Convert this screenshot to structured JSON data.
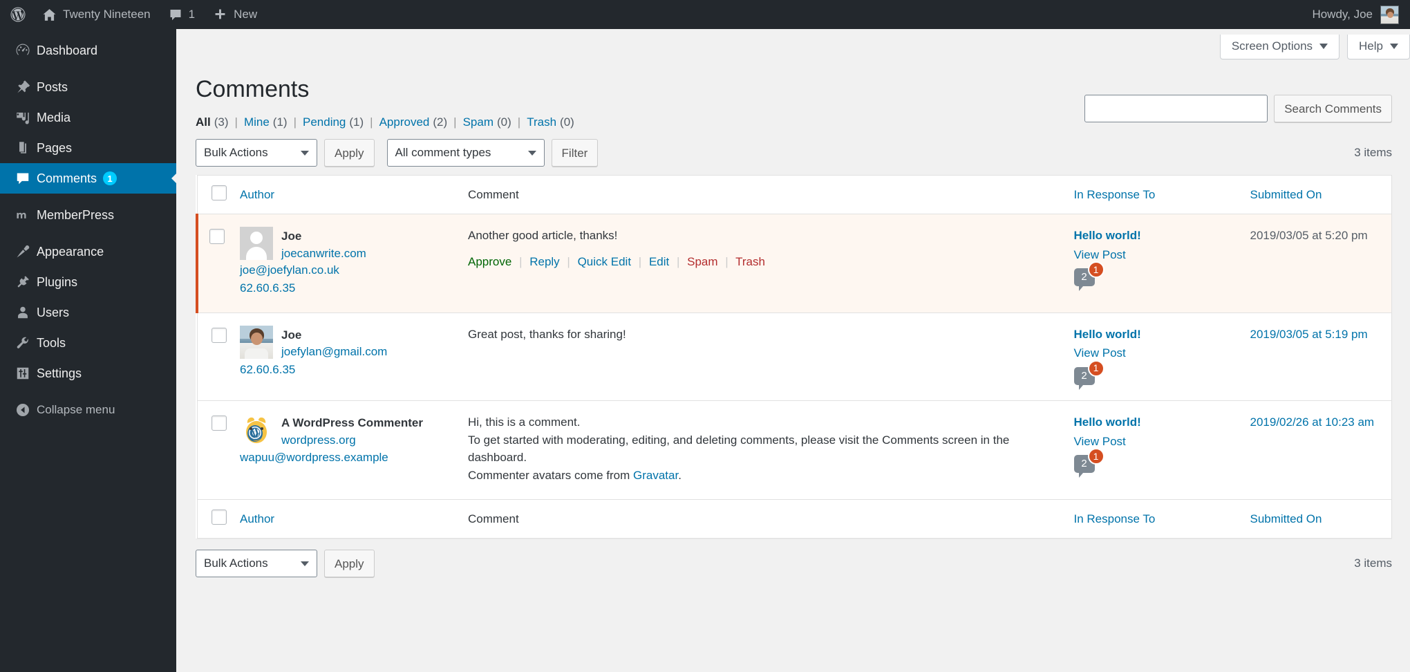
{
  "adminbar": {
    "wp_logo": "wordpress-logo-icon",
    "site_name": "Twenty Nineteen",
    "comments_count": "1",
    "new_label": "New",
    "howdy": "Howdy, Joe"
  },
  "sidebar": {
    "items": [
      {
        "label": "Dashboard",
        "icon": "dashboard-icon",
        "current": false,
        "badge": ""
      },
      {
        "label": "Posts",
        "icon": "pin-icon",
        "current": false,
        "badge": ""
      },
      {
        "label": "Media",
        "icon": "media-icon",
        "current": false,
        "badge": ""
      },
      {
        "label": "Pages",
        "icon": "pages-icon",
        "current": false,
        "badge": ""
      },
      {
        "label": "Comments",
        "icon": "comment-bubble-icon",
        "current": true,
        "badge": "1"
      },
      {
        "label": "MemberPress",
        "icon": "memberpress-icon",
        "current": false,
        "badge": ""
      },
      {
        "label": "Appearance",
        "icon": "paintbrush-icon",
        "current": false,
        "badge": ""
      },
      {
        "label": "Plugins",
        "icon": "plug-icon",
        "current": false,
        "badge": ""
      },
      {
        "label": "Users",
        "icon": "user-icon",
        "current": false,
        "badge": ""
      },
      {
        "label": "Tools",
        "icon": "wrench-icon",
        "current": false,
        "badge": ""
      },
      {
        "label": "Settings",
        "icon": "sliders-icon",
        "current": false,
        "badge": ""
      }
    ],
    "collapse_label": "Collapse menu"
  },
  "screen_meta": {
    "screen_options": "Screen Options",
    "help": "Help"
  },
  "page": {
    "title": "Comments",
    "items_count_top": "3 items",
    "items_count_bottom": "3 items"
  },
  "filters": [
    {
      "label": "All",
      "count": "(3)",
      "current": true
    },
    {
      "label": "Mine",
      "count": "(1)",
      "current": false
    },
    {
      "label": "Pending",
      "count": "(1)",
      "current": false
    },
    {
      "label": "Approved",
      "count": "(2)",
      "current": false
    },
    {
      "label": "Spam",
      "count": "(0)",
      "current": false
    },
    {
      "label": "Trash",
      "count": "(0)",
      "current": false
    }
  ],
  "search": {
    "value": "",
    "placeholder": "",
    "button_label": "Search Comments"
  },
  "toolbar_top": {
    "bulk_actions_label": "Bulk Actions",
    "apply_label": "Apply",
    "comment_types_label": "All comment types",
    "filter_label": "Filter"
  },
  "toolbar_bottom": {
    "bulk_actions_label": "Bulk Actions",
    "apply_label": "Apply"
  },
  "table": {
    "columns": {
      "author": "Author",
      "comment": "Comment",
      "response": "In Response To",
      "date": "Submitted On"
    },
    "rows": [
      {
        "status": "unapproved",
        "avatar": "mystery-person-avatar",
        "author_name": "Joe",
        "author_url": "joecanwrite.com",
        "author_email": "joe@joefylan.co.uk",
        "author_ip": "62.60.6.35",
        "comment_lines": [
          "Another good article, thanks!"
        ],
        "comment_link_text": "",
        "actions": [
          {
            "label": "Approve",
            "kind": "approve"
          },
          {
            "label": "Reply",
            "kind": "link"
          },
          {
            "label": "Quick Edit",
            "kind": "link"
          },
          {
            "label": "Edit",
            "kind": "link"
          },
          {
            "label": "Spam",
            "kind": "spam"
          },
          {
            "label": "Trash",
            "kind": "trash"
          }
        ],
        "response_post": "Hello world!",
        "response_view": "View Post",
        "response_count": "2",
        "response_pending": "1",
        "date": "2019/03/05 at 5:20 pm",
        "date_is_link": false
      },
      {
        "status": "approved",
        "avatar": "photo-avatar",
        "author_name": "Joe",
        "author_url": "",
        "author_email": "joefylan@gmail.com",
        "author_ip": "62.60.6.35",
        "comment_lines": [
          "Great post, thanks for sharing!"
        ],
        "comment_link_text": "",
        "actions": [],
        "response_post": "Hello world!",
        "response_view": "View Post",
        "response_count": "2",
        "response_pending": "1",
        "date": "2019/03/05 at 5:19 pm",
        "date_is_link": true
      },
      {
        "status": "approved",
        "avatar": "wapuu-avatar",
        "author_name": "A WordPress Commenter",
        "author_url": "wordpress.org",
        "author_email": "wapuu@wordpress.example",
        "author_ip": "",
        "comment_lines": [
          "Hi, this is a comment.",
          "To get started with moderating, editing, and deleting comments, please visit the Comments screen in the dashboard.",
          "Commenter avatars come from "
        ],
        "comment_link_text": "Gravatar",
        "comment_tail": ".",
        "actions": [],
        "response_post": "Hello world!",
        "response_view": "View Post",
        "response_count": "2",
        "response_pending": "1",
        "date": "2019/02/26 at 10:23 am",
        "date_is_link": true
      }
    ]
  },
  "colors": {
    "admin_bar": "#23282d",
    "sidebar": "#23282d",
    "current_menu": "#0073aa",
    "link": "#0073aa",
    "approve_green": "#006505",
    "danger_red": "#b32d2e",
    "pending_orange": "#d54e21",
    "badge_cyan": "#00b9eb",
    "page_background": "#f1f1f1"
  }
}
